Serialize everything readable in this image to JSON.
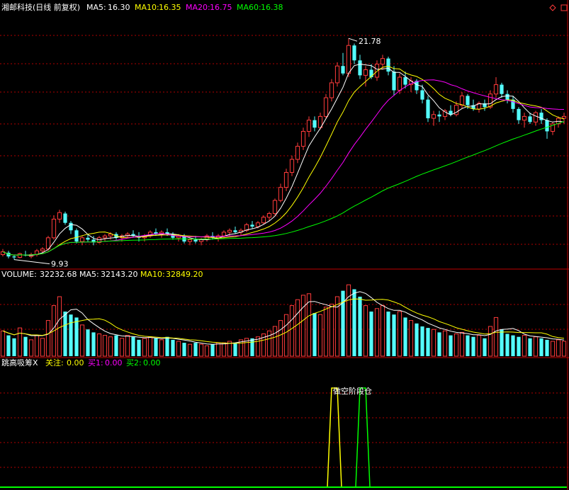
{
  "colors": {
    "up": "#ff3b3b",
    "down": "#54fcfc",
    "ma5": "#ffffff",
    "ma10": "#ffff00",
    "ma20": "#ff00ff",
    "ma60": "#00ff00",
    "grid": "#b00000",
    "border": "#c00000",
    "text": "#ffffff"
  },
  "price_panel": {
    "title": "湘邮科技(日线 前复权)",
    "ma5_label": "MA5:",
    "ma5_value": "16.30",
    "ma10_label": "MA10:",
    "ma10_value": "16.35",
    "ma20_label": "MA20:",
    "ma20_value": "16.75",
    "ma60_label": "MA60:",
    "ma60_value": "16.38",
    "high_label": "21.78",
    "low_label": "9.93"
  },
  "volume_panel": {
    "title": "VOLUME:",
    "value": "32232.68",
    "ma5_label": "MA5:",
    "ma5_value": "32143.20",
    "ma10_label": "MA10:",
    "ma10_value": "32849.20"
  },
  "indicator_panel": {
    "title": "跳高吸筹X",
    "focus_label": "关注:",
    "focus_value": "0.00",
    "buy1_label": "买1:",
    "buy1_value": "0.00",
    "buy2_label": "买2:",
    "buy2_value": "0.00",
    "annotation": "做空阶段仓"
  },
  "chart_data": {
    "type": "candlestick",
    "price_range": [
      9.5,
      23.0
    ],
    "volume_range": [
      0,
      50000
    ],
    "n_bars": 100,
    "candles": [
      [
        10.2,
        10.5,
        10.1,
        10.35
      ],
      [
        10.3,
        10.4,
        10.0,
        10.1
      ],
      [
        10.1,
        10.2,
        9.93,
        10.05
      ],
      [
        10.05,
        10.3,
        10.0,
        10.25
      ],
      [
        10.2,
        10.4,
        10.1,
        10.15
      ],
      [
        10.1,
        10.3,
        10.0,
        10.2
      ],
      [
        10.2,
        10.5,
        10.1,
        10.4
      ],
      [
        10.4,
        10.6,
        10.3,
        10.5
      ],
      [
        10.5,
        11.2,
        10.4,
        11.1
      ],
      [
        11.1,
        12.3,
        11.0,
        12.1
      ],
      [
        12.1,
        12.6,
        11.9,
        12.45
      ],
      [
        12.4,
        12.5,
        11.8,
        11.9
      ],
      [
        11.9,
        12.0,
        11.3,
        11.5
      ],
      [
        11.5,
        11.6,
        10.8,
        10.9
      ],
      [
        10.9,
        11.2,
        10.7,
        11.1
      ],
      [
        11.1,
        11.3,
        10.9,
        11.0
      ],
      [
        11.0,
        11.2,
        10.7,
        10.85
      ],
      [
        10.85,
        11.2,
        10.8,
        11.1
      ],
      [
        11.1,
        11.3,
        10.9,
        11.2
      ],
      [
        11.2,
        11.4,
        11.0,
        11.3
      ],
      [
        11.3,
        11.4,
        11.0,
        11.1
      ],
      [
        11.1,
        11.3,
        10.9,
        11.2
      ],
      [
        11.2,
        11.4,
        11.1,
        11.3
      ],
      [
        11.3,
        11.5,
        11.1,
        11.2
      ],
      [
        11.2,
        11.4,
        10.9,
        11.1
      ],
      [
        11.1,
        11.3,
        10.9,
        11.2
      ],
      [
        11.2,
        11.5,
        11.1,
        11.4
      ],
      [
        11.4,
        11.6,
        11.2,
        11.3
      ],
      [
        11.3,
        11.5,
        11.1,
        11.4
      ],
      [
        11.4,
        11.6,
        11.2,
        11.3
      ],
      [
        11.3,
        11.4,
        11.0,
        11.1
      ],
      [
        11.1,
        11.3,
        10.9,
        11.2
      ],
      [
        11.2,
        11.3,
        10.8,
        10.9
      ],
      [
        10.9,
        11.1,
        10.7,
        11.0
      ],
      [
        11.0,
        11.2,
        10.8,
        10.9
      ],
      [
        10.9,
        11.1,
        10.7,
        11.0
      ],
      [
        11.0,
        11.3,
        10.9,
        11.2
      ],
      [
        11.2,
        11.4,
        11.0,
        11.1
      ],
      [
        11.1,
        11.3,
        10.9,
        11.2
      ],
      [
        11.2,
        11.5,
        11.1,
        11.4
      ],
      [
        11.4,
        11.6,
        11.2,
        11.5
      ],
      [
        11.5,
        11.7,
        11.3,
        11.4
      ],
      [
        11.4,
        11.6,
        11.2,
        11.5
      ],
      [
        11.5,
        11.9,
        11.4,
        11.8
      ],
      [
        11.8,
        12.0,
        11.6,
        11.7
      ],
      [
        11.7,
        12.0,
        11.6,
        11.9
      ],
      [
        11.9,
        12.3,
        11.8,
        12.2
      ],
      [
        12.2,
        12.5,
        12.0,
        12.4
      ],
      [
        12.4,
        13.2,
        12.3,
        13.1
      ],
      [
        13.1,
        14.0,
        13.0,
        13.8
      ],
      [
        13.8,
        14.8,
        13.6,
        14.6
      ],
      [
        14.6,
        15.5,
        14.4,
        15.3
      ],
      [
        15.3,
        16.2,
        15.1,
        16.0
      ],
      [
        16.0,
        17.0,
        15.8,
        16.8
      ],
      [
        16.8,
        17.6,
        16.5,
        17.4
      ],
      [
        17.4,
        17.6,
        16.8,
        17.0
      ],
      [
        17.0,
        17.8,
        16.9,
        17.6
      ],
      [
        17.6,
        18.8,
        17.5,
        18.6
      ],
      [
        18.6,
        19.6,
        18.4,
        19.4
      ],
      [
        19.4,
        20.5,
        19.2,
        20.3
      ],
      [
        20.3,
        21.0,
        19.8,
        19.9
      ],
      [
        19.9,
        21.78,
        19.7,
        21.4
      ],
      [
        21.4,
        21.5,
        20.4,
        20.6
      ],
      [
        20.6,
        20.9,
        19.6,
        19.8
      ],
      [
        19.8,
        20.3,
        19.2,
        20.1
      ],
      [
        20.1,
        20.4,
        19.6,
        19.7
      ],
      [
        19.7,
        20.6,
        19.5,
        20.4
      ],
      [
        20.4,
        20.9,
        20.1,
        20.7
      ],
      [
        20.7,
        20.8,
        19.8,
        20.0
      ],
      [
        20.0,
        20.3,
        18.7,
        19.0
      ],
      [
        19.0,
        19.9,
        18.8,
        19.7
      ],
      [
        19.7,
        20.0,
        19.1,
        19.3
      ],
      [
        19.3,
        19.7,
        18.9,
        19.5
      ],
      [
        19.5,
        19.6,
        18.8,
        19.0
      ],
      [
        19.0,
        19.3,
        18.3,
        18.5
      ],
      [
        18.5,
        18.7,
        17.3,
        17.5
      ],
      [
        17.5,
        17.9,
        17.1,
        17.7
      ],
      [
        17.7,
        17.9,
        17.3,
        17.6
      ],
      [
        17.6,
        18.0,
        17.4,
        17.9
      ],
      [
        17.9,
        18.2,
        17.6,
        17.7
      ],
      [
        17.7,
        18.4,
        17.6,
        18.2
      ],
      [
        18.2,
        18.9,
        18.0,
        18.7
      ],
      [
        18.7,
        18.8,
        18.0,
        18.2
      ],
      [
        18.2,
        18.5,
        17.9,
        18.0
      ],
      [
        18.0,
        18.4,
        17.8,
        18.3
      ],
      [
        18.3,
        18.5,
        17.9,
        18.1
      ],
      [
        18.1,
        19.0,
        18.0,
        18.8
      ],
      [
        18.8,
        19.7,
        18.6,
        19.3
      ],
      [
        19.3,
        19.4,
        18.6,
        18.8
      ],
      [
        18.8,
        19.0,
        18.3,
        18.5
      ],
      [
        18.5,
        18.7,
        17.8,
        18.0
      ],
      [
        18.0,
        18.1,
        17.2,
        17.4
      ],
      [
        17.4,
        17.8,
        17.0,
        17.6
      ],
      [
        17.6,
        17.8,
        17.2,
        17.3
      ],
      [
        17.3,
        17.9,
        17.1,
        17.8
      ],
      [
        17.8,
        18.0,
        17.2,
        17.4
      ],
      [
        17.4,
        17.5,
        16.4,
        16.8
      ],
      [
        16.8,
        17.3,
        16.6,
        17.2
      ],
      [
        17.2,
        17.6,
        17.0,
        17.5
      ],
      [
        17.5,
        17.8,
        17.2,
        17.6
      ]
    ],
    "volume": [
      17000,
      14000,
      12000,
      19000,
      13000,
      11000,
      14000,
      12000,
      24000,
      34000,
      40000,
      30000,
      28000,
      26000,
      21000,
      18000,
      16000,
      15000,
      14000,
      13000,
      14000,
      12000,
      14000,
      13000,
      11000,
      12000,
      13000,
      12000,
      11000,
      13000,
      11000,
      10000,
      9000,
      8000,
      9000,
      8000,
      7000,
      8000,
      9000,
      9000,
      10000,
      9000,
      11000,
      12000,
      12000,
      13000,
      15000,
      17000,
      20000,
      24000,
      28000,
      34000,
      38000,
      41000,
      42000,
      29000,
      28000,
      33000,
      35000,
      40000,
      44000,
      48000,
      45000,
      40000,
      34000,
      30000,
      32000,
      34000,
      30000,
      28000,
      30000,
      26000,
      24000,
      22000,
      20000,
      19000,
      18000,
      16000,
      17000,
      14000,
      15000,
      16000,
      14000,
      13000,
      14000,
      12000,
      20000,
      26000,
      18000,
      15000,
      14000,
      13000,
      14000,
      12000,
      13000,
      12000,
      11000,
      10000,
      11000,
      10000
    ],
    "indicator": {
      "range": [
        0,
        1
      ],
      "buy1_spike_x": [
        468,
        476
      ],
      "buy2_spike_x": [
        508,
        516
      ]
    }
  }
}
